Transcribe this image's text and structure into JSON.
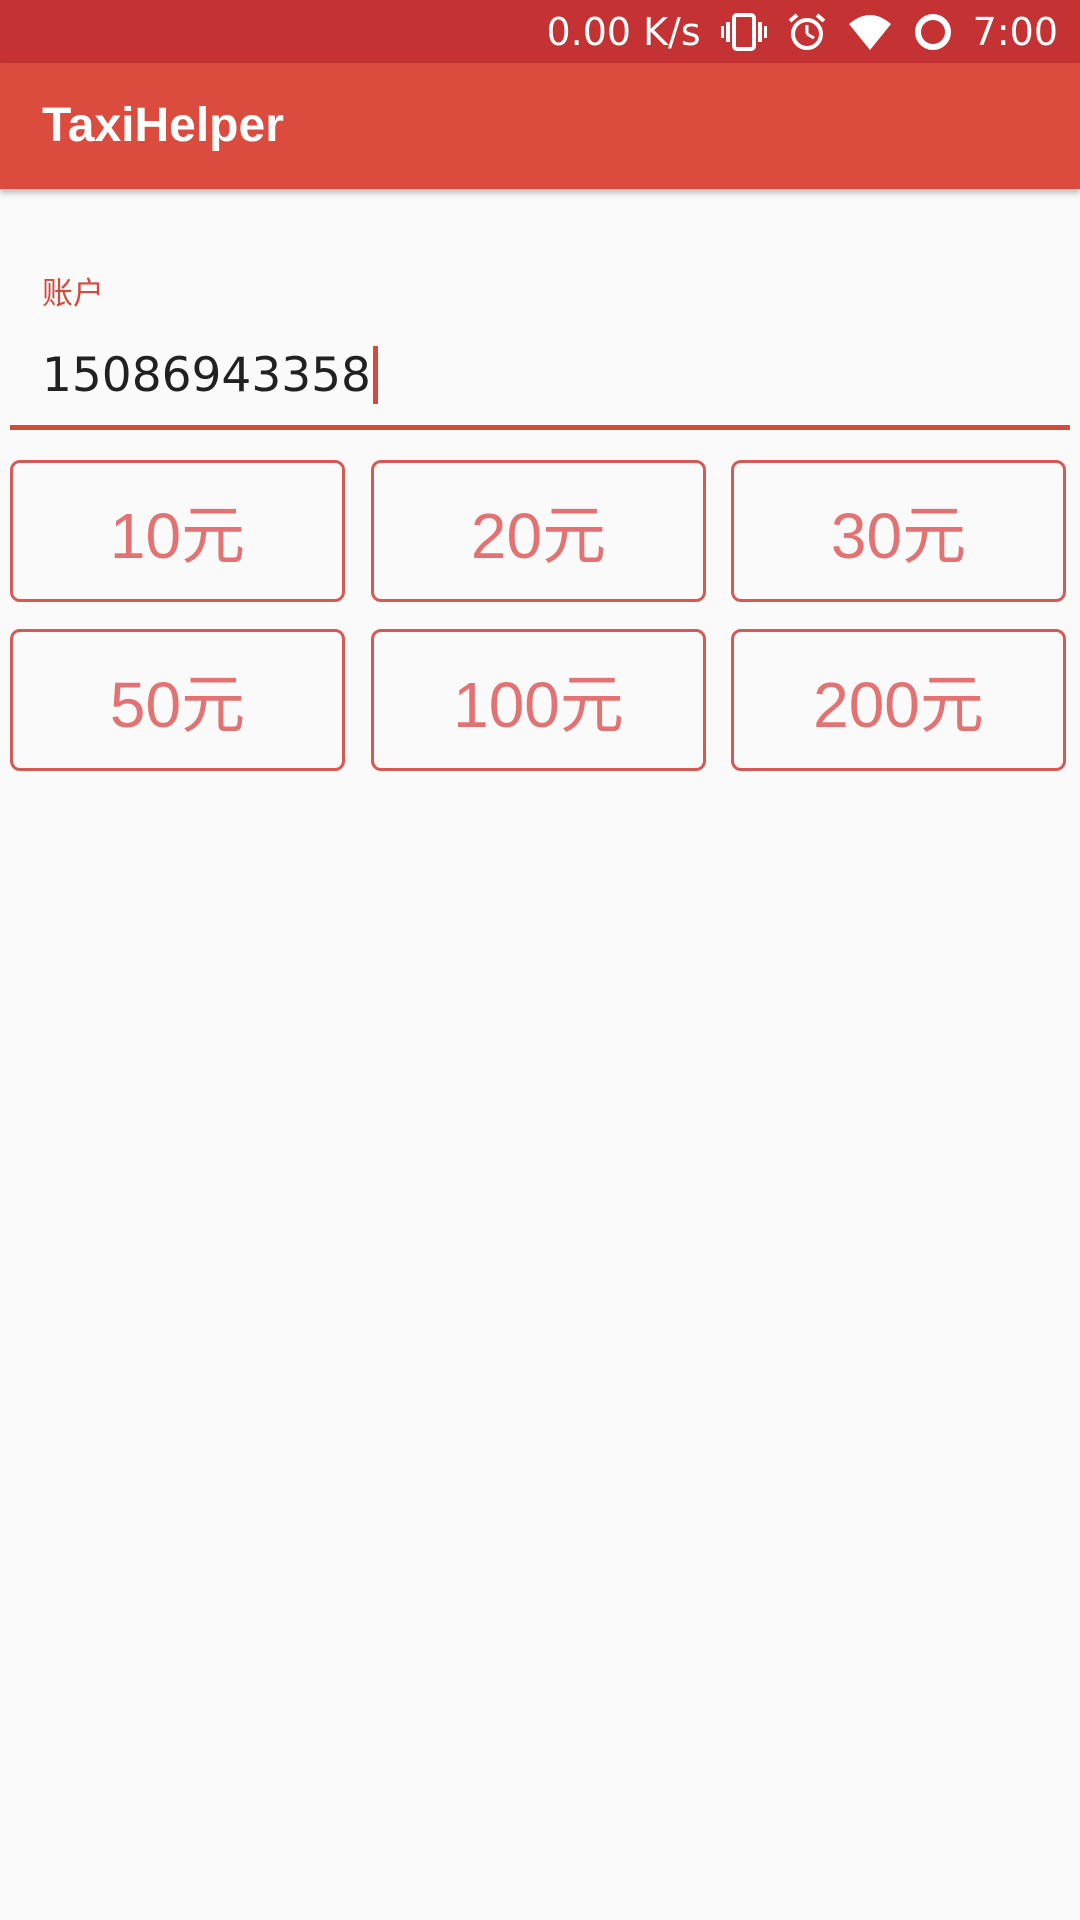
{
  "status_bar": {
    "net_speed": "0.00 K/s",
    "time": "7:00",
    "icons": [
      "vibrate-icon",
      "alarm-icon",
      "wifi-icon",
      "circle-icon"
    ]
  },
  "app_bar": {
    "title": "TaxiHelper"
  },
  "account": {
    "label": "账户",
    "value": "15086943358"
  },
  "amounts": [
    {
      "label": "10元"
    },
    {
      "label": "20元"
    },
    {
      "label": "30元"
    },
    {
      "label": "50元"
    },
    {
      "label": "100元"
    },
    {
      "label": "200元"
    }
  ],
  "colors": {
    "status_bar": "#c43233",
    "app_bar": "#db4c3f",
    "accent": "#d24b3c",
    "button_text": "#e27372"
  }
}
